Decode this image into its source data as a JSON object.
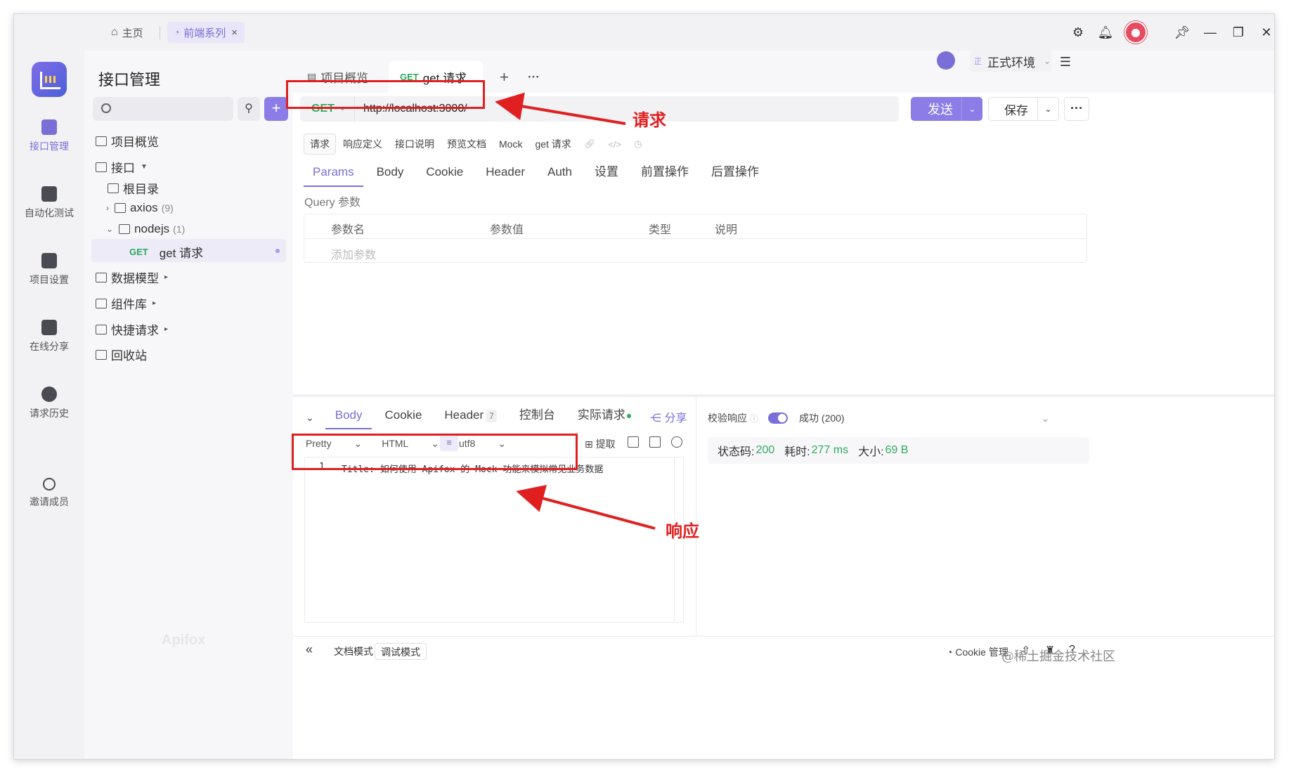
{
  "titlebar": {
    "home_label": "主页",
    "active_tab_label": "前端系列",
    "active_tab_close": "×",
    "icons": [
      "gear-icon",
      "bell-icon",
      "avatar",
      "pin-icon",
      "minimize-icon",
      "restore-icon",
      "close-icon"
    ]
  },
  "rail": {
    "items": [
      {
        "label": "接口管理",
        "active": true
      },
      {
        "label": "自动化测试"
      },
      {
        "label": "项目设置"
      },
      {
        "label": "在线分享"
      },
      {
        "label": "请求历史"
      },
      {
        "label": "邀请成员"
      }
    ]
  },
  "sidebar": {
    "title": "接口管理",
    "search_placeholder": "",
    "add_label": "+",
    "tree": {
      "overview": "项目概览",
      "api": "接口",
      "root": "根目录",
      "axios": "axios",
      "axios_count": "(9)",
      "nodejs": "nodejs",
      "nodejs_count": "(1)",
      "req_method": "GET",
      "req_name": "get 请求",
      "data_model": "数据模型",
      "components": "组件库",
      "quick_request": "快捷请求",
      "recycle": "回收站"
    },
    "watermark": "Apifox"
  },
  "main": {
    "tabs": [
      {
        "label": "项目概览"
      },
      {
        "method": "GET",
        "label": "get 请求",
        "active": true
      }
    ],
    "add_tab": "+",
    "more_tabs": "···",
    "environment": {
      "badge": "正",
      "label": "正式环境"
    },
    "request": {
      "method": "GET",
      "url": "http://localhost:3000/",
      "send": "发送",
      "save": "保存",
      "more": "···"
    },
    "subtabs": [
      "请求",
      "响应定义",
      "接口说明",
      "预览文档",
      "Mock"
    ],
    "subtab_name": "get 请求",
    "param_tabs": [
      "Params",
      "Body",
      "Cookie",
      "Header",
      "Auth",
      "设置",
      "前置操作",
      "后置操作"
    ],
    "query_label": "Query 参数",
    "query_columns": [
      "参数名",
      "参数值",
      "类型",
      "说明"
    ],
    "query_add": "添加参数"
  },
  "response": {
    "tabs": [
      "Body",
      "Cookie",
      "Header",
      "控制台",
      "实际请求"
    ],
    "header_count": "7",
    "share": "分享",
    "format": {
      "pretty": "Pretty",
      "type": "HTML",
      "encoding": "utf8"
    },
    "extract": "提取",
    "line_number": "1",
    "body_text": "Title: 如何使用 Apifox 的 Mock 功能来模拟常见业务数据",
    "verify_label": "校验响应",
    "verify_status": "成功 (200)",
    "status_label": "状态码:",
    "status_value": "200",
    "time_label": "耗时:",
    "time_value": "277 ms",
    "size_label": "大小:",
    "size_value": "69 B"
  },
  "bottom": {
    "doc_mode": "文档模式",
    "debug_mode": "调试模式",
    "cookie_mgr": "Cookie 管理"
  },
  "annotations": {
    "request": "请求",
    "response": "响应",
    "color": "#e02020"
  },
  "credit": "@稀土掘金技术社区",
  "colors": {
    "accent": "#7a6fd6",
    "get_green": "#2eaa5e",
    "send_bg": "#8b7ce8"
  }
}
